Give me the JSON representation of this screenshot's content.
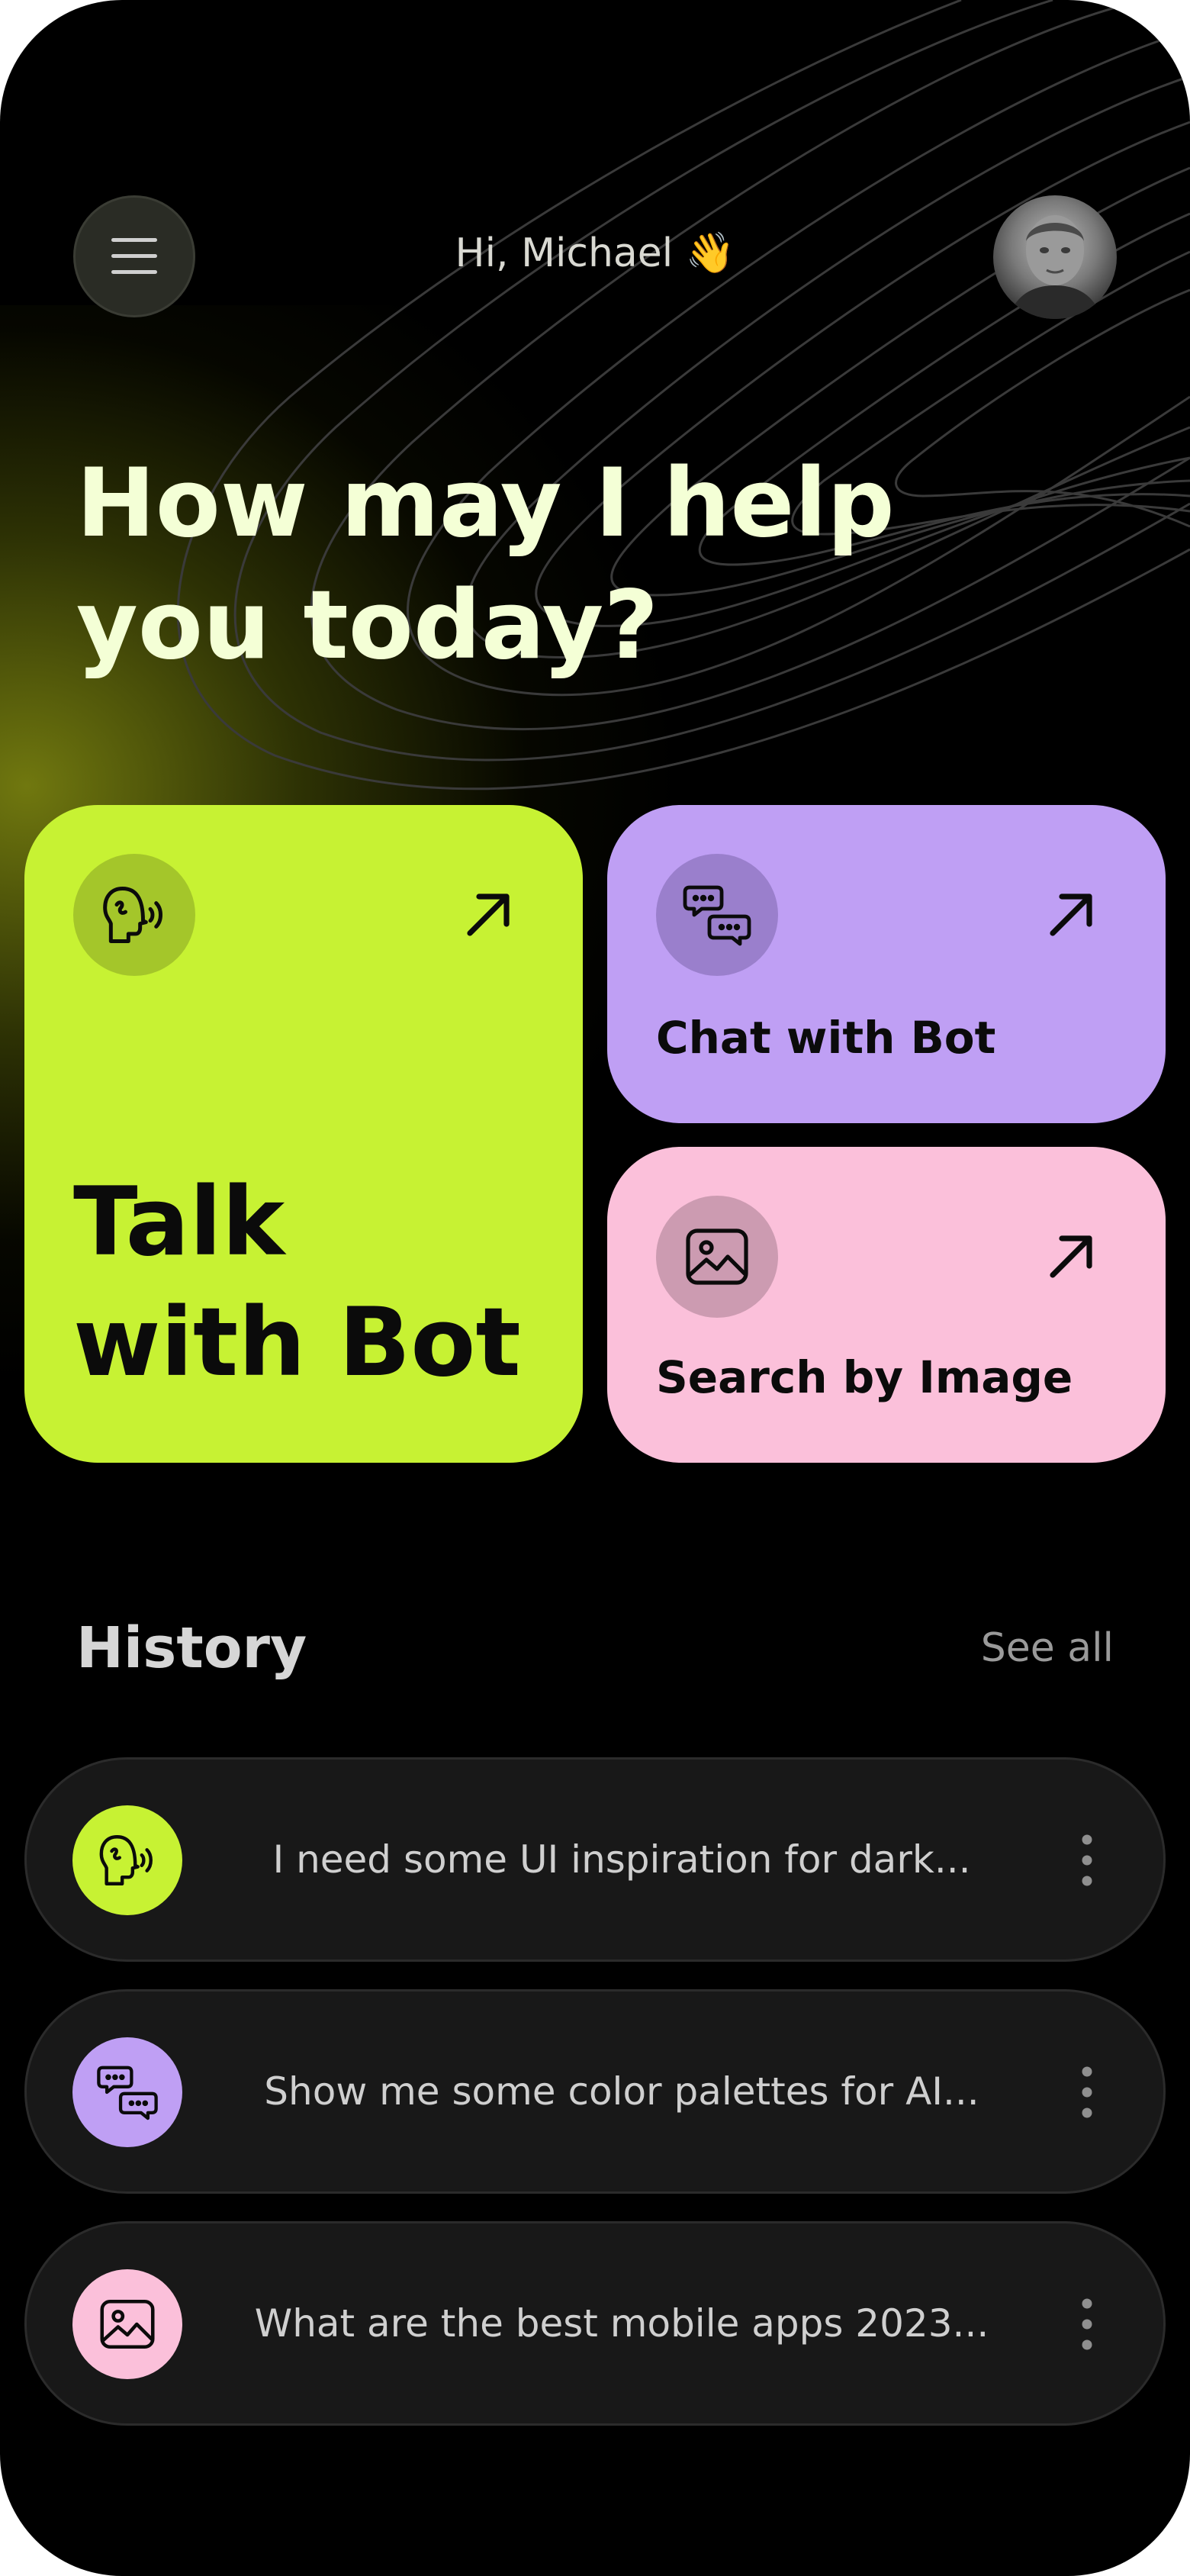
{
  "header": {
    "greeting": "Hi, Michael 👋",
    "menu_icon": "hamburger-menu-icon",
    "avatar_icon": "user-avatar"
  },
  "headline": {
    "line1": "How may I help",
    "line2": "you today?"
  },
  "cards": {
    "talk": {
      "line1": "Talk",
      "line2": "with Bot",
      "icon": "speaking-head-icon",
      "arrow": "arrow-up-right-icon",
      "color": "#c7f233"
    },
    "chat": {
      "label": "Chat with Bot",
      "icon": "chat-bubbles-icon",
      "arrow": "arrow-up-right-icon",
      "color": "#bf9ff4"
    },
    "image": {
      "label": "Search by Image",
      "icon": "image-icon",
      "arrow": "arrow-up-right-icon",
      "color": "#fbc0da"
    }
  },
  "history": {
    "title": "History",
    "see_all": "See all",
    "items": [
      {
        "text": "I need some UI inspiration for dark...",
        "icon": "speaking-head-icon",
        "color": "#c7f233"
      },
      {
        "text": "Show me some color palettes for AI...",
        "icon": "chat-bubbles-icon",
        "color": "#bf9ff4"
      },
      {
        "text": "What are the best mobile apps 2023...",
        "icon": "image-icon",
        "color": "#fbc0da"
      }
    ]
  },
  "colors": {
    "background": "#000000",
    "lime": "#c7f233",
    "lavender": "#bf9ff4",
    "pink": "#fbc0da",
    "headline": "#f4ffd6"
  }
}
